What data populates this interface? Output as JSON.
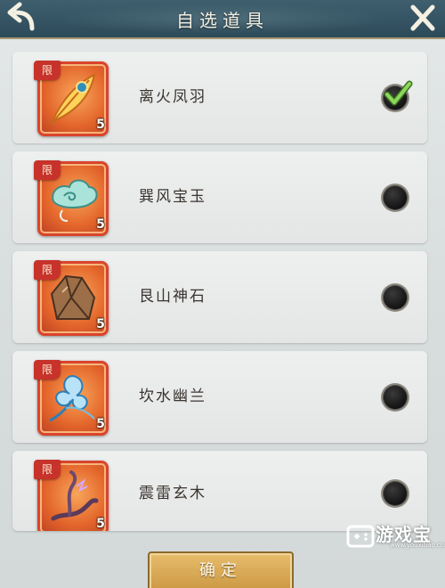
{
  "header": {
    "title": "自选道具",
    "back_icon": "back-arrow-icon",
    "close_icon": "close-icon"
  },
  "items": [
    {
      "name": "离火凤羽",
      "limit_tag": "限",
      "quantity": "5",
      "icon": "phoenix-feather-icon",
      "selected": true
    },
    {
      "name": "巽风宝玉",
      "limit_tag": "限",
      "quantity": "5",
      "icon": "wind-jade-icon",
      "selected": false
    },
    {
      "name": "艮山神石",
      "limit_tag": "限",
      "quantity": "5",
      "icon": "mountain-stone-icon",
      "selected": false
    },
    {
      "name": "坎水幽兰",
      "limit_tag": "限",
      "quantity": "5",
      "icon": "water-orchid-icon",
      "selected": false
    },
    {
      "name": "震雷玄木",
      "limit_tag": "限",
      "quantity": "5",
      "icon": "thunder-wood-icon",
      "selected": false
    }
  ],
  "confirm_label": "确定",
  "watermark": {
    "text": "游戏宝",
    "url": "www.youxibao.com"
  },
  "colors": {
    "header": "#2d4a59",
    "icon_frame": "#e3652b",
    "limit_tag": "#c7332a",
    "check": "#5fb83a",
    "confirm": "#d9ab5a"
  }
}
